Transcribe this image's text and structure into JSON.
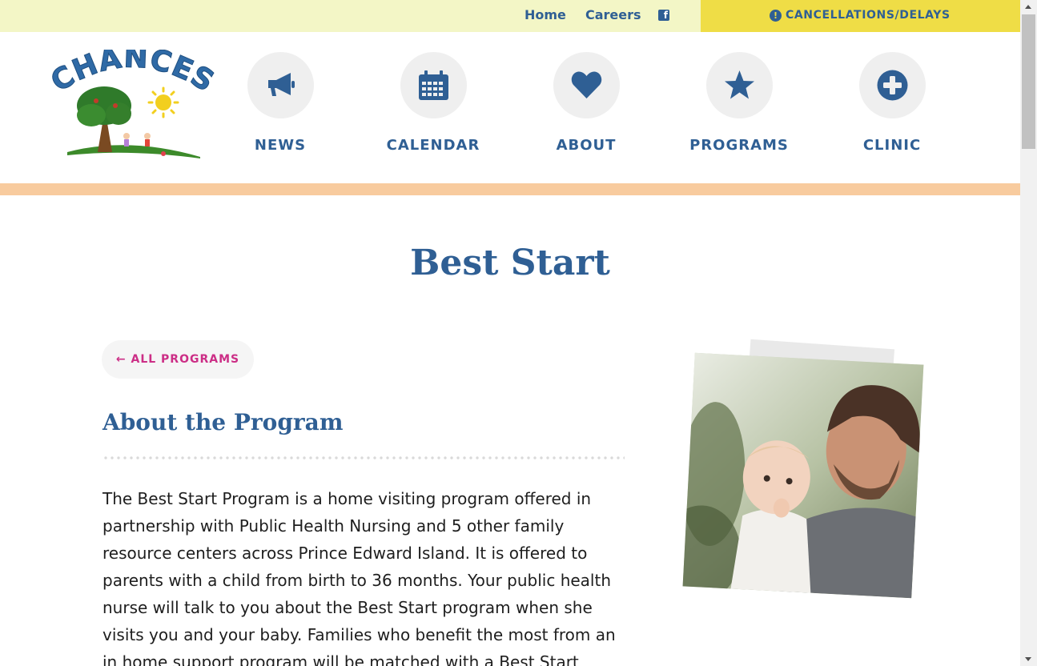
{
  "topbar": {
    "links": [
      {
        "label": "Home"
      },
      {
        "label": "Careers"
      }
    ],
    "facebook_icon": "facebook-icon",
    "alert": {
      "icon": "exclamation-circle-icon",
      "label": "CANCELLATIONS/DELAYS"
    }
  },
  "logo": {
    "text": "CHANCES"
  },
  "nav": {
    "items": [
      {
        "label": "NEWS",
        "icon": "megaphone-icon"
      },
      {
        "label": "CALENDAR",
        "icon": "calendar-icon"
      },
      {
        "label": "ABOUT",
        "icon": "heart-icon"
      },
      {
        "label": "PROGRAMS",
        "icon": "star-icon"
      },
      {
        "label": "CLINIC",
        "icon": "plus-circle-icon"
      }
    ]
  },
  "main": {
    "title": "Best Start",
    "back_link": "← ALL PROGRAMS",
    "section_title": "About the Program",
    "body": "The Best Start Program is a home visiting program offered in partnership with Public Health Nursing and 5 other family resource centers across Prince Edward Island. It is offered to parents with a child from birth to 36 months. Your public health nurse will talk to you about the Best Start program when she visits you and your baby. Families who benefit the most from an in home support program will be matched with a Best Start"
  },
  "colors": {
    "brand_blue": "#2f5f94",
    "topbar_bg": "#f3f6c6",
    "alert_bg": "#efdd46",
    "accent_peach": "#f8cb9e",
    "link_pink": "#cc2e86"
  }
}
